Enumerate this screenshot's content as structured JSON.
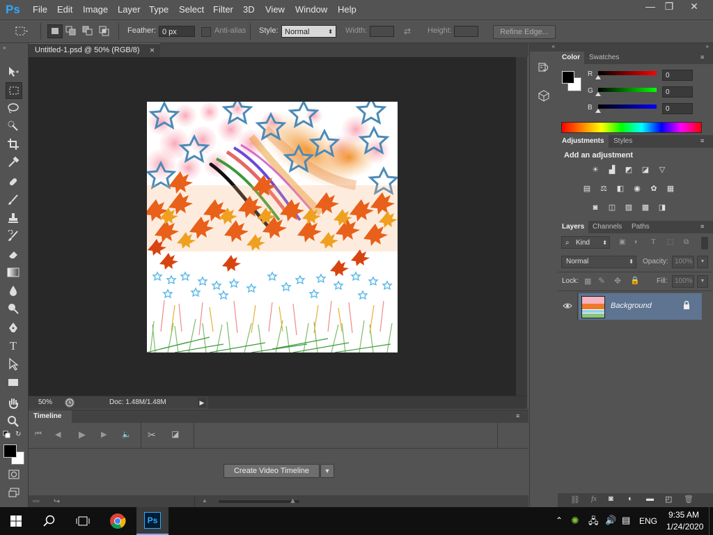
{
  "app": {
    "logo": "Ps"
  },
  "menu": [
    "File",
    "Edit",
    "Image",
    "Layer",
    "Type",
    "Select",
    "Filter",
    "3D",
    "View",
    "Window",
    "Help"
  ],
  "window_controls": {
    "minimize": "—",
    "restore": "❐",
    "close": "✕"
  },
  "options": {
    "feather_label": "Feather:",
    "feather_value": "0 px",
    "antialias_label": "Anti-alias",
    "style_label": "Style:",
    "style_value": "Normal",
    "width_label": "Width:",
    "height_label": "Height:",
    "refine_edge": "Refine Edge..."
  },
  "document": {
    "tab_title": "Untitled-1.psd @ 50% (RGB/8)",
    "close_glyph": "×",
    "zoom": "50%",
    "doc_info": "Doc: 1.48M/1.48M"
  },
  "timeline": {
    "tab": "Timeline",
    "create_button": "Create Video Timeline"
  },
  "color_panel": {
    "tabs": [
      "Color",
      "Swatches"
    ],
    "channels": [
      {
        "label": "R",
        "value": "0",
        "color": "#ff0000"
      },
      {
        "label": "G",
        "value": "0",
        "color": "#00ff00"
      },
      {
        "label": "B",
        "value": "0",
        "color": "#0000ff"
      }
    ],
    "foreground": "#000000",
    "background": "#ffffff"
  },
  "adjustments_panel": {
    "tabs": [
      "Adjustments",
      "Styles"
    ],
    "heading": "Add an adjustment"
  },
  "layers_panel": {
    "tabs": [
      "Layers",
      "Channels",
      "Paths"
    ],
    "filter_kind": "Kind",
    "blend_mode": "Normal",
    "opacity_label": "Opacity:",
    "opacity_value": "100%",
    "lock_label": "Lock:",
    "fill_label": "Fill:",
    "fill_value": "100%",
    "layers": [
      {
        "name": "Background",
        "visible": true,
        "locked": true
      }
    ]
  },
  "taskbar": {
    "language": "ENG",
    "time": "9:35 AM",
    "date": "1/24/2020",
    "ps_label": "Ps"
  }
}
